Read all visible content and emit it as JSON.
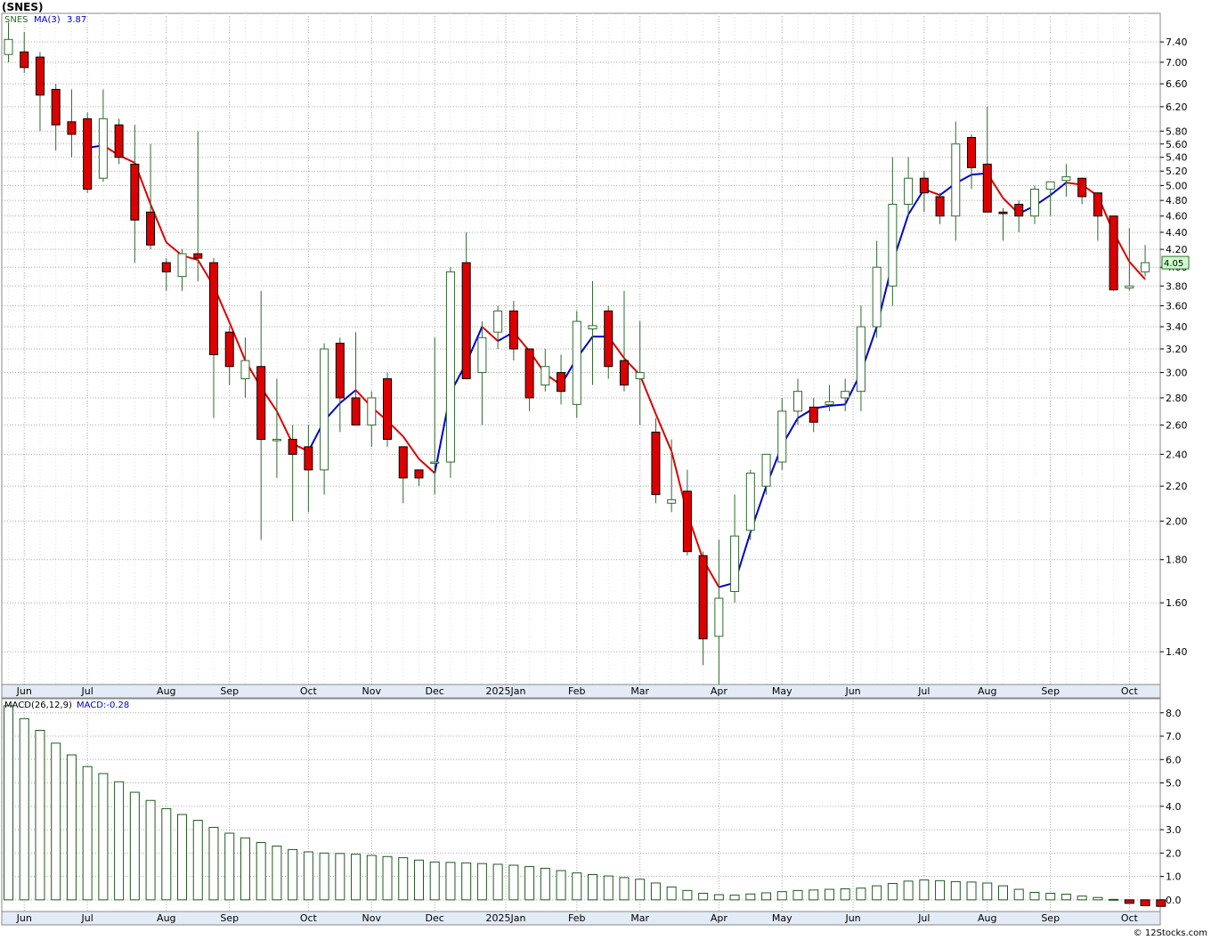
{
  "title": "(SNES)",
  "footer": "© 12Stocks.com",
  "colors": {
    "up": "#2f6b2f",
    "down": "#dd0000",
    "ma_up": "#0000cc",
    "ma_down": "#dd0000",
    "macd": "#1f5a1f",
    "grid": "#aaaaaa",
    "last_bg": "#ccffcc"
  },
  "price_panel": {
    "legend": {
      "symbol": "SNES",
      "ma_label": "MA(3)",
      "ma_value": "3.87"
    },
    "y_ticks": [
      "7.40",
      "7.00",
      "6.60",
      "6.20",
      "5.80",
      "5.60",
      "5.40",
      "5.20",
      "5.00",
      "4.80",
      "4.60",
      "4.40",
      "4.20",
      "4.00",
      "3.80",
      "3.60",
      "3.40",
      "3.20",
      "3.00",
      "2.80",
      "2.60",
      "2.40",
      "2.20",
      "2.00",
      "1.80",
      "1.60",
      "1.40"
    ],
    "scale": "log",
    "last_price": "4.05"
  },
  "macd_panel": {
    "legend": {
      "label": "MACD(26,12,9)",
      "value_label": "MACD:-0.28"
    },
    "y_ticks": [
      "8.0",
      "7.0",
      "6.0",
      "5.0",
      "4.0",
      "3.0",
      "2.0",
      "1.0",
      "0.0"
    ]
  },
  "x_labels": [
    "Jun",
    "Jul",
    "Aug",
    "Sep",
    "Oct",
    "Nov",
    "Dec",
    "2025Jan",
    "Feb",
    "Mar",
    "Apr",
    "May",
    "Jun",
    "Jul",
    "Aug",
    "Sep",
    "Oct"
  ],
  "chart_data": {
    "type": "candlestick",
    "scale": "log",
    "ylim": [
      1.28,
      8.0
    ],
    "weeks": [
      {
        "o": 7.15,
        "h": 7.8,
        "l": 7.0,
        "c": 7.45
      },
      {
        "o": 7.2,
        "h": 7.6,
        "l": 6.8,
        "c": 6.9
      },
      {
        "o": 7.1,
        "h": 7.2,
        "l": 5.8,
        "c": 6.4
      },
      {
        "o": 6.5,
        "h": 6.6,
        "l": 5.5,
        "c": 5.9
      },
      {
        "o": 5.95,
        "h": 6.5,
        "l": 5.4,
        "c": 5.75
      },
      {
        "o": 6.0,
        "h": 6.1,
        "l": 4.9,
        "c": 4.95
      },
      {
        "o": 5.1,
        "h": 6.5,
        "l": 5.05,
        "c": 6.0
      },
      {
        "o": 5.9,
        "h": 6.0,
        "l": 5.3,
        "c": 5.4
      },
      {
        "o": 5.3,
        "h": 5.9,
        "l": 4.05,
        "c": 4.55
      },
      {
        "o": 4.65,
        "h": 5.6,
        "l": 4.2,
        "c": 4.25
      },
      {
        "o": 4.05,
        "h": 4.1,
        "l": 3.75,
        "c": 3.95
      },
      {
        "o": 3.9,
        "h": 4.2,
        "l": 3.75,
        "c": 4.15
      },
      {
        "o": 4.15,
        "h": 5.8,
        "l": 3.85,
        "c": 4.1
      },
      {
        "o": 4.05,
        "h": 4.1,
        "l": 2.65,
        "c": 3.15
      },
      {
        "o": 3.35,
        "h": 3.4,
        "l": 2.9,
        "c": 3.05
      },
      {
        "o": 2.95,
        "h": 3.3,
        "l": 2.8,
        "c": 3.1
      },
      {
        "o": 3.05,
        "h": 3.75,
        "l": 1.9,
        "c": 2.5
      },
      {
        "o": 2.5,
        "h": 2.95,
        "l": 2.25,
        "c": 2.5
      },
      {
        "o": 2.5,
        "h": 2.6,
        "l": 2.0,
        "c": 2.4
      },
      {
        "o": 2.45,
        "h": 2.6,
        "l": 2.05,
        "c": 2.3
      },
      {
        "o": 2.3,
        "h": 3.25,
        "l": 2.15,
        "c": 3.2
      },
      {
        "o": 3.25,
        "h": 3.3,
        "l": 2.55,
        "c": 2.8
      },
      {
        "o": 2.8,
        "h": 3.35,
        "l": 2.6,
        "c": 2.6
      },
      {
        "o": 2.6,
        "h": 2.85,
        "l": 2.45,
        "c": 2.8
      },
      {
        "o": 2.95,
        "h": 3.0,
        "l": 2.45,
        "c": 2.5
      },
      {
        "o": 2.45,
        "h": 2.45,
        "l": 2.1,
        "c": 2.25
      },
      {
        "o": 2.3,
        "h": 2.3,
        "l": 2.2,
        "c": 2.25
      },
      {
        "o": 2.35,
        "h": 3.3,
        "l": 2.15,
        "c": 2.35
      },
      {
        "o": 2.35,
        "h": 4.0,
        "l": 2.25,
        "c": 3.95
      },
      {
        "o": 4.05,
        "h": 4.4,
        "l": 2.95,
        "c": 2.95
      },
      {
        "o": 3.0,
        "h": 3.45,
        "l": 2.6,
        "c": 3.3
      },
      {
        "o": 3.35,
        "h": 3.6,
        "l": 3.2,
        "c": 3.55
      },
      {
        "o": 3.55,
        "h": 3.65,
        "l": 3.1,
        "c": 3.2
      },
      {
        "o": 3.2,
        "h": 3.2,
        "l": 2.7,
        "c": 2.8
      },
      {
        "o": 2.9,
        "h": 3.2,
        "l": 2.85,
        "c": 3.05
      },
      {
        "o": 3.0,
        "h": 3.15,
        "l": 2.75,
        "c": 2.85
      },
      {
        "o": 2.75,
        "h": 3.55,
        "l": 2.65,
        "c": 3.45
      },
      {
        "o": 3.38,
        "h": 3.85,
        "l": 2.9,
        "c": 3.41
      },
      {
        "o": 3.55,
        "h": 3.6,
        "l": 2.95,
        "c": 3.05
      },
      {
        "o": 3.1,
        "h": 3.75,
        "l": 2.85,
        "c": 2.9
      },
      {
        "o": 2.95,
        "h": 3.45,
        "l": 2.6,
        "c": 3.0
      },
      {
        "o": 2.55,
        "h": 2.65,
        "l": 2.1,
        "c": 2.15
      },
      {
        "o": 2.1,
        "h": 2.5,
        "l": 2.05,
        "c": 2.12
      },
      {
        "o": 2.17,
        "h": 2.3,
        "l": 1.82,
        "c": 1.84
      },
      {
        "o": 1.82,
        "h": 1.84,
        "l": 1.35,
        "c": 1.45
      },
      {
        "o": 1.46,
        "h": 1.9,
        "l": 1.28,
        "c": 1.62
      },
      {
        "o": 1.65,
        "h": 2.15,
        "l": 1.6,
        "c": 1.92
      },
      {
        "o": 1.95,
        "h": 2.3,
        "l": 1.9,
        "c": 2.28
      },
      {
        "o": 2.2,
        "h": 2.4,
        "l": 2.15,
        "c": 2.4
      },
      {
        "o": 2.35,
        "h": 2.8,
        "l": 2.3,
        "c": 2.7
      },
      {
        "o": 2.7,
        "h": 2.95,
        "l": 2.6,
        "c": 2.85
      },
      {
        "o": 2.73,
        "h": 2.8,
        "l": 2.55,
        "c": 2.62
      },
      {
        "o": 2.75,
        "h": 2.9,
        "l": 2.7,
        "c": 2.77
      },
      {
        "o": 2.8,
        "h": 2.95,
        "l": 2.7,
        "c": 2.85
      },
      {
        "o": 2.85,
        "h": 3.6,
        "l": 2.7,
        "c": 3.4
      },
      {
        "o": 3.4,
        "h": 4.3,
        "l": 3.3,
        "c": 4.0
      },
      {
        "o": 3.8,
        "h": 5.4,
        "l": 3.6,
        "c": 4.75
      },
      {
        "o": 4.75,
        "h": 5.4,
        "l": 4.6,
        "c": 5.1
      },
      {
        "o": 5.1,
        "h": 5.2,
        "l": 4.65,
        "c": 4.9
      },
      {
        "o": 4.85,
        "h": 4.9,
        "l": 4.5,
        "c": 4.6
      },
      {
        "o": 4.6,
        "h": 5.95,
        "l": 4.3,
        "c": 5.6
      },
      {
        "o": 5.7,
        "h": 5.75,
        "l": 4.95,
        "c": 5.25
      },
      {
        "o": 5.3,
        "h": 6.2,
        "l": 4.65,
        "c": 4.65
      },
      {
        "o": 4.65,
        "h": 4.7,
        "l": 4.3,
        "c": 4.63
      },
      {
        "o": 4.75,
        "h": 4.8,
        "l": 4.4,
        "c": 4.6
      },
      {
        "o": 4.6,
        "h": 5.0,
        "l": 4.5,
        "c": 4.95
      },
      {
        "o": 4.95,
        "h": 5.05,
        "l": 4.6,
        "c": 5.05
      },
      {
        "o": 5.07,
        "h": 5.3,
        "l": 4.85,
        "c": 5.12
      },
      {
        "o": 5.1,
        "h": 5.1,
        "l": 4.75,
        "c": 4.85
      },
      {
        "o": 4.9,
        "h": 4.9,
        "l": 4.3,
        "c": 4.6
      },
      {
        "o": 4.6,
        "h": 4.6,
        "l": 3.75,
        "c": 3.76
      },
      {
        "o": 3.78,
        "h": 4.45,
        "l": 3.75,
        "c": 3.8
      },
      {
        "o": 3.95,
        "h": 4.25,
        "l": 3.9,
        "c": 4.05
      }
    ],
    "ma3": [
      null,
      null,
      null,
      null,
      null,
      5.54,
      5.58,
      5.43,
      5.32,
      4.75,
      4.28,
      4.13,
      4.08,
      3.8,
      3.44,
      3.1,
      2.88,
      2.7,
      2.47,
      2.42,
      2.63,
      2.76,
      2.86,
      2.73,
      2.63,
      2.52,
      2.37,
      2.28,
      2.84,
      3.08,
      3.4,
      3.27,
      3.35,
      3.18,
      2.99,
      2.9,
      3.12,
      3.31,
      3.31,
      3.12,
      2.98,
      2.68,
      2.42,
      2.04,
      1.8,
      1.67,
      1.69,
      1.94,
      2.2,
      2.46,
      2.65,
      2.72,
      2.74,
      2.75,
      3.0,
      3.4,
      4.05,
      4.62,
      4.95,
      4.87,
      5.03,
      5.15,
      5.17,
      4.83,
      4.63,
      4.73,
      4.87,
      5.04,
      5.01,
      4.86,
      4.4,
      4.06,
      3.87
    ],
    "macd": [
      8.3,
      7.75,
      7.25,
      6.7,
      6.2,
      5.7,
      5.4,
      5.05,
      4.6,
      4.25,
      3.9,
      3.65,
      3.4,
      3.1,
      2.85,
      2.65,
      2.45,
      2.3,
      2.15,
      2.05,
      2.0,
      1.98,
      1.95,
      1.9,
      1.85,
      1.8,
      1.7,
      1.62,
      1.6,
      1.58,
      1.55,
      1.52,
      1.48,
      1.42,
      1.35,
      1.25,
      1.15,
      1.08,
      1.02,
      0.95,
      0.88,
      0.72,
      0.55,
      0.4,
      0.28,
      0.22,
      0.2,
      0.25,
      0.3,
      0.35,
      0.4,
      0.42,
      0.45,
      0.47,
      0.5,
      0.6,
      0.7,
      0.8,
      0.85,
      0.82,
      0.78,
      0.76,
      0.72,
      0.6,
      0.45,
      0.32,
      0.28,
      0.24,
      0.16,
      0.1,
      0.02,
      -0.15,
      -0.25,
      -0.28
    ]
  }
}
